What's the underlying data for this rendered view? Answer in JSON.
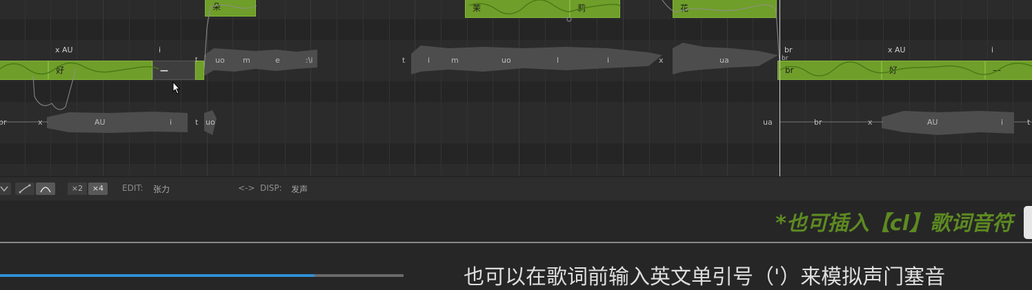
{
  "notes_top": [
    "朵",
    "茉",
    "莉",
    "花"
  ],
  "notes_mid": [
    "好",
    "—",
    "br",
    "好",
    "—"
  ],
  "phonemes_mid": [
    "x AU",
    "i",
    "t",
    "br",
    "x AU",
    "i"
  ],
  "phonemes_wave": [
    "uo",
    "m",
    "e",
    ":\\i",
    "t",
    "i",
    "m",
    "uo",
    "l",
    "i",
    "x",
    "ua",
    "br"
  ],
  "phonemes_bottom": [
    "br",
    "x",
    "AU",
    "i",
    "t",
    "uo",
    "ua",
    "br",
    "x",
    "AU",
    "i",
    "t"
  ],
  "toolbar": {
    "x2": "×2",
    "x4": "×4",
    "edit_label": "EDIT:",
    "edit_value": "张力",
    "disp_icon": "<->",
    "disp_label": "DISP:",
    "disp_value": "发声"
  },
  "tip": "*也可插入【cl】歌词音符",
  "subtitle": "也可以在歌词前输入英文单引号（'）来模拟声门塞音",
  "progress": 0.78,
  "colors": {
    "note_green": "#6f9e2a",
    "tip_green": "#5d8a22",
    "progress_blue": "#2f8fd6"
  }
}
